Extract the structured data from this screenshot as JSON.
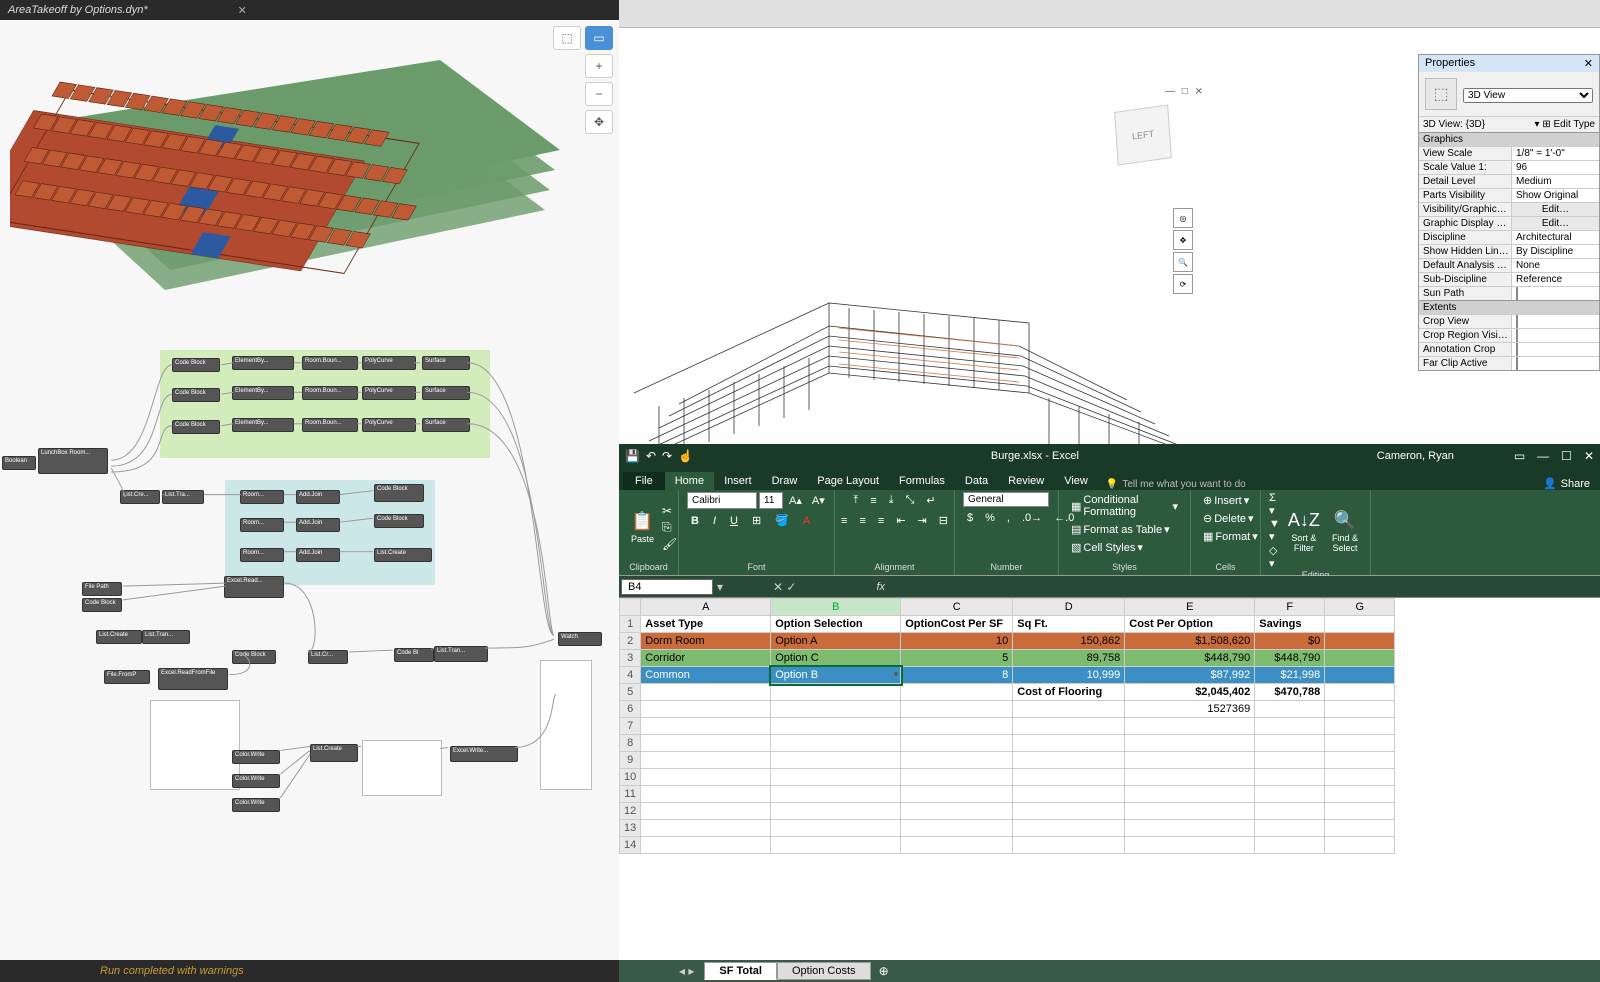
{
  "dynamo": {
    "tab_title": "AreaTakeoff by Options.dyn*",
    "status": "Run completed with warnings",
    "toolbar": {
      "plus": "+",
      "minus": "−",
      "pan": "✥"
    },
    "view_cube": "LEFT"
  },
  "revit": {
    "top_controls": "— □ ⨯",
    "properties_title": "Properties",
    "view_type": "3D View",
    "view_name": "3D View: {3D}",
    "edit_type": "Edit Type",
    "sections": {
      "graphics": "Graphics",
      "extents": "Extents"
    },
    "rows": [
      {
        "k": "View Scale",
        "v": "1/8\" = 1'-0\""
      },
      {
        "k": "Scale Value    1:",
        "v": "96"
      },
      {
        "k": "Detail Level",
        "v": "Medium"
      },
      {
        "k": "Parts Visibility",
        "v": "Show Original"
      },
      {
        "k": "Visibility/Graphic…",
        "v": "Edit…",
        "btn": true
      },
      {
        "k": "Graphic Display …",
        "v": "Edit…",
        "btn": true
      },
      {
        "k": "Discipline",
        "v": "Architectural"
      },
      {
        "k": "Show Hidden Lin…",
        "v": "By Discipline"
      },
      {
        "k": "Default Analysis …",
        "v": "None"
      },
      {
        "k": "Sub-Discipline",
        "v": "Reference"
      },
      {
        "k": "Sun Path",
        "v": "",
        "check": true
      }
    ],
    "extents_rows": [
      {
        "k": "Crop View",
        "check": true
      },
      {
        "k": "Crop Region Visi…",
        "check": true
      },
      {
        "k": "Annotation Crop",
        "check": true
      },
      {
        "k": "Far Clip Active",
        "check": true
      }
    ]
  },
  "excel": {
    "filename": "Burge.xlsx - Excel",
    "user": "Cameron, Ryan",
    "share": "Share",
    "tabs": [
      "File",
      "Home",
      "Insert",
      "Draw",
      "Page Layout",
      "Formulas",
      "Data",
      "Review",
      "View"
    ],
    "active_tab": "Home",
    "tellme": "Tell me what you want to do",
    "ribbon": {
      "clipboard": "Clipboard",
      "paste": "Paste",
      "font": "Font",
      "fontname": "Calibri",
      "fontsize": "11",
      "alignment": "Alignment",
      "number": "Number",
      "numfmt": "General",
      "styles": "Styles",
      "cf": "Conditional Formatting",
      "fat": "Format as Table",
      "cs": "Cell Styles",
      "cells": "Cells",
      "insert": "Insert",
      "delete": "Delete",
      "format": "Format",
      "editing": "Editing",
      "sf": "Sort & Filter",
      "fs": "Find & Select"
    },
    "namebox": "B4",
    "columns": [
      "",
      "A",
      "B",
      "C",
      "D",
      "E",
      "F",
      "G"
    ],
    "rows": [
      {
        "n": "1",
        "cells": [
          "Asset Type",
          "Option Selection",
          "OptionCost Per SF",
          "Sq Ft.",
          "Cost Per Option",
          "Savings",
          ""
        ],
        "cls": "hdr"
      },
      {
        "n": "2",
        "cells": [
          "Dorm Room",
          "Option A",
          "10",
          "150,862",
          "$1,508,620",
          "$0",
          ""
        ],
        "cls": "orange"
      },
      {
        "n": "3",
        "cells": [
          "Corridor",
          "Option C",
          "5",
          "89,758",
          "$448,790",
          "$448,790",
          ""
        ],
        "cls": "green"
      },
      {
        "n": "4",
        "cells": [
          "Common",
          "Option B",
          "8",
          "10,999",
          "$87,992",
          "$21,998",
          ""
        ],
        "cls": "blue"
      },
      {
        "n": "5",
        "cells": [
          "",
          "",
          "",
          "Cost of Flooring",
          "$2,045,402",
          "$470,788",
          ""
        ],
        "cls": "total"
      },
      {
        "n": "6",
        "cells": [
          "",
          "",
          "",
          "",
          "1527369",
          "",
          ""
        ]
      },
      {
        "n": "7",
        "cells": [
          "",
          "",
          "",
          "",
          "",
          "",
          ""
        ]
      },
      {
        "n": "8",
        "cells": [
          "",
          "",
          "",
          "",
          "",
          "",
          ""
        ]
      },
      {
        "n": "9",
        "cells": [
          "",
          "",
          "",
          "",
          "",
          "",
          ""
        ]
      },
      {
        "n": "10",
        "cells": [
          "",
          "",
          "",
          "",
          "",
          "",
          ""
        ]
      },
      {
        "n": "11",
        "cells": [
          "",
          "",
          "",
          "",
          "",
          "",
          ""
        ]
      },
      {
        "n": "12",
        "cells": [
          "",
          "",
          "",
          "",
          "",
          "",
          ""
        ]
      },
      {
        "n": "13",
        "cells": [
          "",
          "",
          "",
          "",
          "",
          "",
          ""
        ]
      },
      {
        "n": "14",
        "cells": [
          "",
          "",
          "",
          "",
          "",
          "",
          ""
        ]
      }
    ],
    "sheets": [
      "SF Total",
      "Option Costs"
    ],
    "active_sheet": "SF Total"
  }
}
